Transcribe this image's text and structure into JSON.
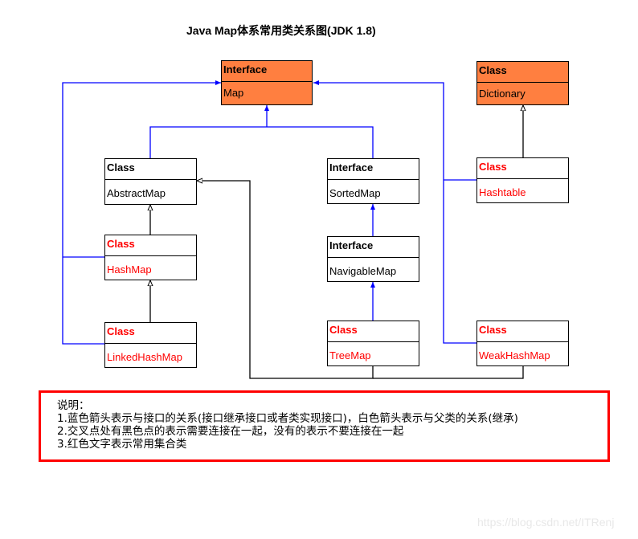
{
  "title": "Java Map体系常用类关系图(JDK 1.8)",
  "nodes": {
    "map": {
      "kind": "Interface",
      "name": "Map",
      "common": false,
      "fill": "#ff7f40"
    },
    "dictionary": {
      "kind": "Class",
      "name": "Dictionary",
      "common": false,
      "fill": "#ff7f40"
    },
    "abstractmap": {
      "kind": "Class",
      "name": "AbstractMap",
      "common": false
    },
    "sortedmap": {
      "kind": "Interface",
      "name": "SortedMap",
      "common": false
    },
    "hashtable": {
      "kind": "Class",
      "name": "Hashtable",
      "common": true
    },
    "hashmap": {
      "kind": "Class",
      "name": "HashMap",
      "common": true
    },
    "navigablemap": {
      "kind": "Interface",
      "name": "NavigableMap",
      "common": false
    },
    "linkedhashmap": {
      "kind": "Class",
      "name": "LinkedHashMap",
      "common": true
    },
    "treemap": {
      "kind": "Class",
      "name": "TreeMap",
      "common": true
    },
    "weakhashmap": {
      "kind": "Class",
      "name": "WeakHashMap",
      "common": true
    }
  },
  "edges": [
    {
      "from": "AbstractMap",
      "to": "Map",
      "type": "interface"
    },
    {
      "from": "SortedMap",
      "to": "Map",
      "type": "interface"
    },
    {
      "from": "HashMap",
      "to": "Map",
      "type": "interface"
    },
    {
      "from": "LinkedHashMap",
      "to": "Map",
      "type": "interface"
    },
    {
      "from": "Hashtable",
      "to": "Map",
      "type": "interface"
    },
    {
      "from": "WeakHashMap",
      "to": "Map",
      "type": "interface"
    },
    {
      "from": "NavigableMap",
      "to": "SortedMap",
      "type": "interface"
    },
    {
      "from": "TreeMap",
      "to": "NavigableMap",
      "type": "interface"
    },
    {
      "from": "HashMap",
      "to": "AbstractMap",
      "type": "class"
    },
    {
      "from": "LinkedHashMap",
      "to": "HashMap",
      "type": "class"
    },
    {
      "from": "Hashtable",
      "to": "Dictionary",
      "type": "class"
    },
    {
      "from": "TreeMap",
      "to": "AbstractMap",
      "type": "class"
    },
    {
      "from": "WeakHashMap",
      "to": "AbstractMap",
      "type": "class"
    }
  ],
  "colors": {
    "interface_arrow": "#0000ff",
    "class_arrow": "#000000",
    "common_text": "#ff0000",
    "note_border": "#ff0000"
  },
  "note": {
    "heading": "说明：",
    "lines": [
      "1.蓝色箭头表示与接口的关系(接口继承接口或者类实现接口)，白色箭头表示与父类的关系(继承)",
      "2.交叉点处有黑色点的表示需要连接在一起，没有的表示不要连接在一起",
      "3.红色文字表示常用集合类"
    ]
  },
  "watermark": "https://blog.csdn.net/ITRenj"
}
